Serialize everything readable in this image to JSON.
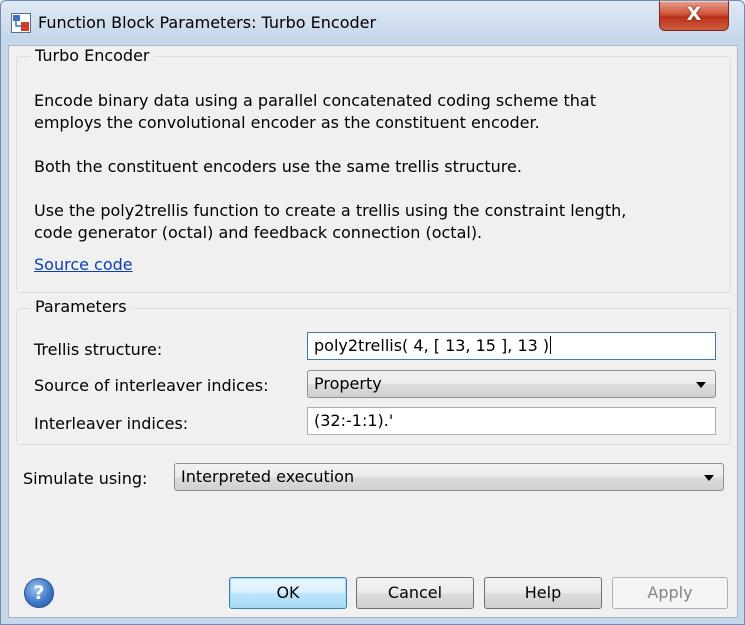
{
  "window": {
    "title": "Function Block Parameters: Turbo Encoder",
    "close_symbol": "X"
  },
  "mask_group": {
    "legend": "Turbo Encoder",
    "description_lines": [
      "Encode binary data using a parallel concatenated coding scheme that",
      "employs the convolutional encoder as the constituent encoder.",
      "Both the constituent encoders use the same trellis structure.",
      "Use the poly2trellis function to create a trellis using the constraint length,",
      "code generator (octal) and feedback connection (octal)."
    ],
    "source_code_link": "Source code"
  },
  "parameters": {
    "legend": "Parameters",
    "trellis_structure": {
      "label": "Trellis structure:",
      "value": "poly2trellis( 4, [ 13, 15 ], 13 )"
    },
    "interleaver_source": {
      "label": "Source of interleaver indices:",
      "value": "Property"
    },
    "interleaver_indices": {
      "label": "Interleaver indices:",
      "value": "(32:-1:1).'"
    }
  },
  "simulate": {
    "label": "Simulate using:",
    "value": "Interpreted execution"
  },
  "buttons": {
    "help_icon": "?",
    "ok": "OK",
    "cancel": "Cancel",
    "help": "Help",
    "apply": "Apply"
  },
  "icons": {
    "app": "simulink-block-icon",
    "close": "close-icon",
    "help": "help-circle-icon",
    "dropdown": "chevron-down-icon"
  }
}
